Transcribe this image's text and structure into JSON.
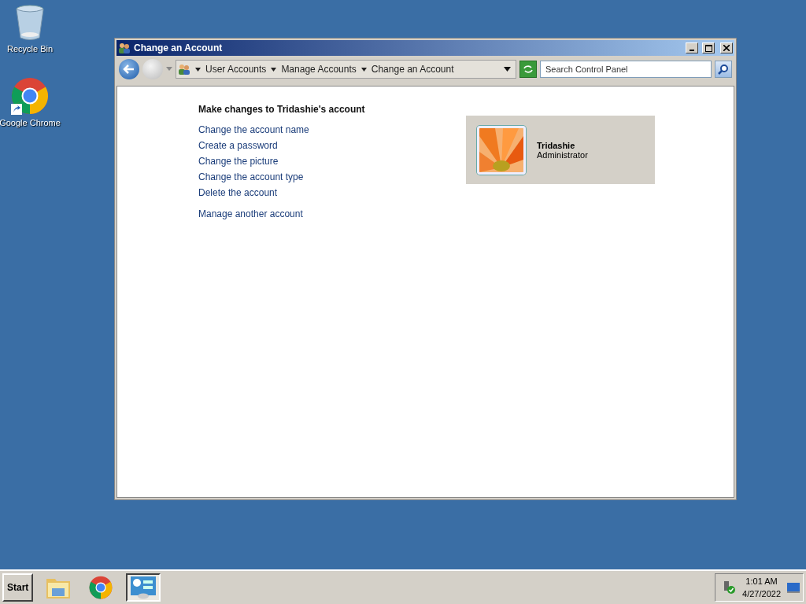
{
  "desktop_icons": [
    {
      "kind": "recycle",
      "label": "Recycle Bin"
    },
    {
      "kind": "chrome",
      "label": "Google Chrome"
    }
  ],
  "window": {
    "title": "Change an Account",
    "breadcrumb": [
      "User Accounts",
      "Manage Accounts",
      "Change an Account"
    ],
    "search": {
      "placeholder": "Search Control Panel"
    },
    "heading": "Make changes to Tridashie's account",
    "links": [
      "Change the account name",
      "Create a password",
      "Change the picture",
      "Change the account type",
      "Delete the account"
    ],
    "other_link": "Manage another account",
    "account": {
      "name": "Tridashie",
      "type": "Administrator"
    }
  },
  "taskbar": {
    "start": "Start",
    "buttons": [
      {
        "kind": "explorer",
        "selected": false
      },
      {
        "kind": "chrome",
        "selected": false
      },
      {
        "kind": "control-panel",
        "selected": true
      }
    ],
    "clock": {
      "time": "1:01 AM",
      "date": "4/27/2022"
    }
  }
}
